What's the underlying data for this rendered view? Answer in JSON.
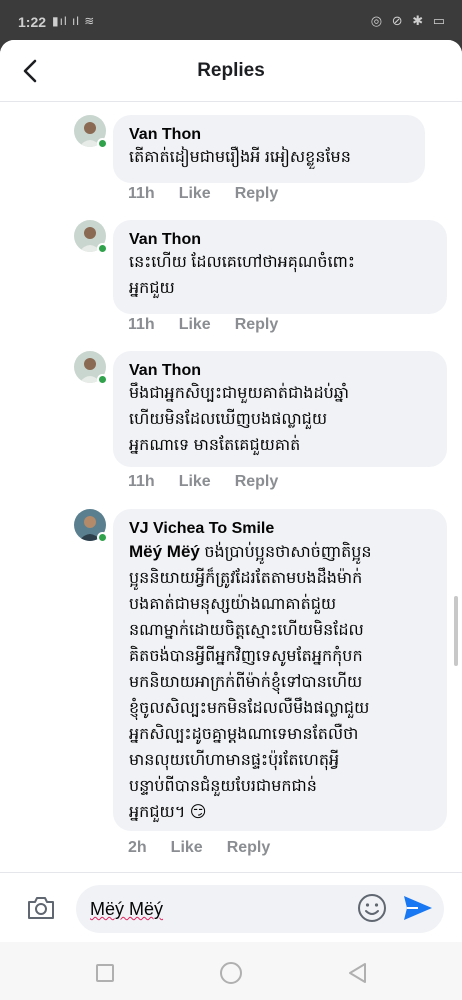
{
  "status_bar": {
    "time": "1:22",
    "left_icons": "▮ıl ıl ≋",
    "right_icons": "◎ ⊘ ✱ ▭"
  },
  "header": {
    "title": "Replies",
    "back_icon": "chevron-left-icon"
  },
  "comments": [
    {
      "author": "Van Thon",
      "text": "តើគាត់ដៀមជាមរឿងអី រអៀសខ្លួនមែន",
      "time": "11h",
      "like": "Like",
      "reply": "Reply"
    },
    {
      "author": "Van Thon",
      "text": "នេះហើយ ដែលគេហៅថាអគុណចំពោះ\nអ្នកជួយ",
      "time": "11h",
      "like": "Like",
      "reply": "Reply"
    },
    {
      "author": "Van Thon",
      "text": "មឹងជាអ្នកសិប្បះជាមួយគាត់ជាងដប់ឆ្នាំ\nហើយមិនដែលឃើញបងផល្លាជួយ\nអ្នកណាទេ មានតែគេជួយគាត់",
      "time": "11h",
      "like": "Like",
      "reply": "Reply"
    },
    {
      "author": "VJ Vichea To Smile",
      "mention": "Mëý Mëý",
      "text": " ចង់ប្រាប់ប្អូនថាសាច់ញាតិប្អូន\nប្អូននិយាយអ្វីក៏ត្រូវដែរតែតាមបងដឹងម៉ាក់\nបងគាត់ជាមនុស្សយ៉ាងណាគាត់ជួយ\nនណាម្នាក់ដោយចិត្តស្មោះហើយមិនដែល\nគិតចង់បានអ្វីពីអ្នកវិញទេសូមតែអ្នកកុំបក\nមកនិយាយអាក្រក់ពីម៉ាក់ខ្ញុំទៅបានហើយ\nខ្ញុំចូលសិល្បះមកមិនដែលលឺមឹងផល្លាជួយ\nអ្នកសិល្បះដូចគ្នាម្តងណាទេមានតែលឺថា\nមានលុយហើហាមានផ្ទះប៉ុរតែហេតុអ្វី\nបន្ទាប់ពីបានជំនួយបែរជាមកជាន់\nអ្នកជួយ។ 😏",
      "time": "2h",
      "like": "Like",
      "reply": "Reply"
    }
  ],
  "composer": {
    "value": "Mëý Mëý",
    "camera_icon": "camera-icon",
    "emoji_icon": "emoji-icon",
    "send_icon": "send-icon"
  },
  "colors": {
    "accent": "#1877f2",
    "online": "#31a24c",
    "bubble": "#f0f2f5",
    "meta": "#8a8d91"
  }
}
